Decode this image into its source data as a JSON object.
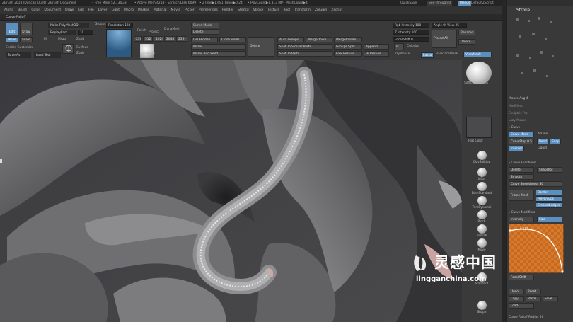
{
  "titlebar": {
    "app": "ZBrush 2018 [Duncan Quet]",
    "doc": "ZBrush Document",
    "free_mem": "• Free Mem 52.136GB",
    "active_mem": "• Active Mem 4258",
    "scratch": "• Scratch Disk 6099",
    "ztime": "• ZTime▶1.681 Timer▶0.24",
    "polycount": "• PolyCount▶1.313 MP",
    "meshcount": "• MeshCount▶4",
    "quicksave": "QuickSave",
    "seethrough": "See-through  0",
    "menus": "Menus",
    "default_script": "DefaultZScript"
  },
  "menubar": [
    "Alpha",
    "Brush",
    "Color",
    "Document",
    "Draw",
    "Edit",
    "File",
    "Layer",
    "Light",
    "Macro",
    "Marker",
    "Material",
    "Movie",
    "Picker",
    "Preferences",
    "Render",
    "Stencil",
    "Stroke",
    "Texture",
    "Tool",
    "Transform",
    "Zplugin",
    "Zscript"
  ],
  "palette_title": "Curve Falloff",
  "shelf": {
    "edit": "Edit",
    "draw": "Draw",
    "move": "Move",
    "scale": "Scale",
    "rotate": "Rotate",
    "make_polymesh": "Make PolyMesh3D",
    "replay_last": "ReplayLast",
    "replay_value": "10",
    "save_as": "Save As",
    "load_tool": "Load Tool",
    "enable_customize": "Enable Customize",
    "m": "M",
    "mrgb": "Mrgb",
    "rgb": "Rgb",
    "zadd": "Zadd",
    "zsub": "Zsub",
    "surface": "Surface",
    "gizmo": "Gizmo",
    "dynamesh": "DynaMesh",
    "resolution": "Resolution 128",
    "project": "Project",
    "groups": "Groups",
    "polish": "Polish",
    "curve_mode": "Curve Mode",
    "delete": "Delete",
    "del_hidden": "Del Hidden",
    "close_holes": "Close Holes",
    "mirror": "Mirror",
    "mirror_weld": "Mirror And Weld",
    "delete2": "Delete",
    "auto_groups": "Auto Groups",
    "merge_down": "MergeDown",
    "merge_visible": "MergeVisible",
    "split_similar": "Split To Similar Parts",
    "groups_split": "Groups Split",
    "append": "Append",
    "split_parts": "Split To Parts",
    "low_res": "Low Res.vis",
    "hi_res": "Hi Res.vis",
    "rgb_intensity": "Rgb Intensity 100",
    "z_intensity": "Z Intensity 100",
    "focal_shift": "Focal Shift 0",
    "colorize": "Colorize",
    "lazymouse": "LazyMouse",
    "angle_of_view": "Angle Of View 25",
    "project_all": "ProjectAll",
    "rename": "Rename",
    "delete3": "Delete",
    "lasso": "Lasso",
    "backface": "BackfaceMask",
    "viewmask": "ViewMask",
    "sizes": [
      "256",
      "512",
      "1024",
      "2048"
    ],
    "brush_label": "DynaMesh",
    "dots": "ClayBuildup"
  },
  "right_shelf": {
    "matcap": "SoftClayMatcap",
    "flat_color": "Flat Color",
    "tools": [
      "ClayBuildup",
      "Inflat",
      "DamStandard",
      "TrimDynamic",
      "Pinch",
      "hPolish",
      "Move",
      "Standard",
      "Shape"
    ]
  },
  "panel": {
    "title": "Stroke",
    "mouse_avg": "Mouse Avg 4",
    "modifiers": "Modifiers",
    "sculptris_pro": "Sculptris Pro",
    "lazy_mouse": "Lazy Mouse",
    "curve_header": "▸ Curve",
    "curve_mode": "Curve Mode",
    "as_line": "AsLine",
    "curve_step": "CurveStep 0.5",
    "bend": "Bend",
    "snap": "Snap",
    "intersection": "Intersect",
    "liquid": "Liquid",
    "curve_functions": "▸ Curve Functions",
    "delete": "Delete",
    "snapshot": "Snapshot",
    "smooth": "Smooth",
    "curve_smoothness": "Curve Smoothness 30",
    "frame_mesh": "Frame Mesh",
    "border": "Border",
    "polygroups": "Polygroups",
    "creased_edges": "Creased edges",
    "curve_modifiers": "▸ Curve Modifiers",
    "intensity": "Intensity",
    "size": "Size",
    "focal_shift": "Focal Shift",
    "reset": "Reset",
    "undo": "Undo",
    "copy": "Copy",
    "paste": "Paste",
    "save": "Save",
    "load": "Load",
    "curve_falloff_label": "Curve Falloff Radius 20",
    "curve_value": "0.817"
  },
  "watermark": {
    "cn": "灵感中国",
    "url": "lingganchina.com"
  },
  "colors": {
    "accent": "#5a8fbf",
    "curve_bg": "#d97a2a",
    "watermark": "#ffffff"
  }
}
